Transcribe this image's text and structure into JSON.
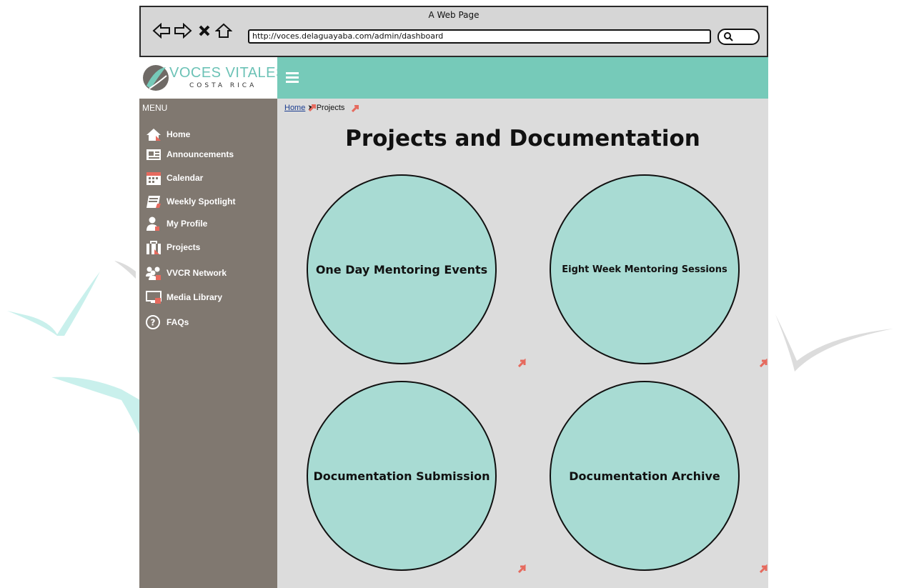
{
  "browser": {
    "title": "A Web Page",
    "url": "http://voces.delaguayaba.com/admin/dashboard"
  },
  "logo": {
    "line1": "VOCES VITALES",
    "line2": "COSTA RICA"
  },
  "colors": {
    "header_teal": "#76cab9",
    "sidebar_brown": "#807870",
    "circle_fill": "#a8dbd3",
    "content_bg": "#dcdcdc",
    "marker_red": "#e66a5e"
  },
  "sidebar": {
    "title": "MENU",
    "items": [
      {
        "label": "Home",
        "icon": "home-icon"
      },
      {
        "label": "Announcements",
        "icon": "newspaper-icon"
      },
      {
        "label": "Calendar",
        "icon": "calendar-icon"
      },
      {
        "label": "Weekly Spotlight",
        "icon": "book-icon"
      },
      {
        "label": "My Profile",
        "icon": "user-icon"
      },
      {
        "label": "Projects",
        "icon": "briefcase-icon"
      },
      {
        "label": "VVCR Network",
        "icon": "group-icon"
      },
      {
        "label": "Media Library",
        "icon": "monitor-icon"
      },
      {
        "label": "FAQs",
        "icon": "help-icon"
      }
    ]
  },
  "breadcrumb": {
    "home": "Home",
    "current": "Projects"
  },
  "main": {
    "title": "Projects and Documentation",
    "tiles": [
      {
        "label": "One Day Mentoring Events"
      },
      {
        "label": "Eight Week Mentoring Sessions"
      },
      {
        "label": "Documentation Submission"
      },
      {
        "label": "Documentation Archive"
      }
    ]
  }
}
